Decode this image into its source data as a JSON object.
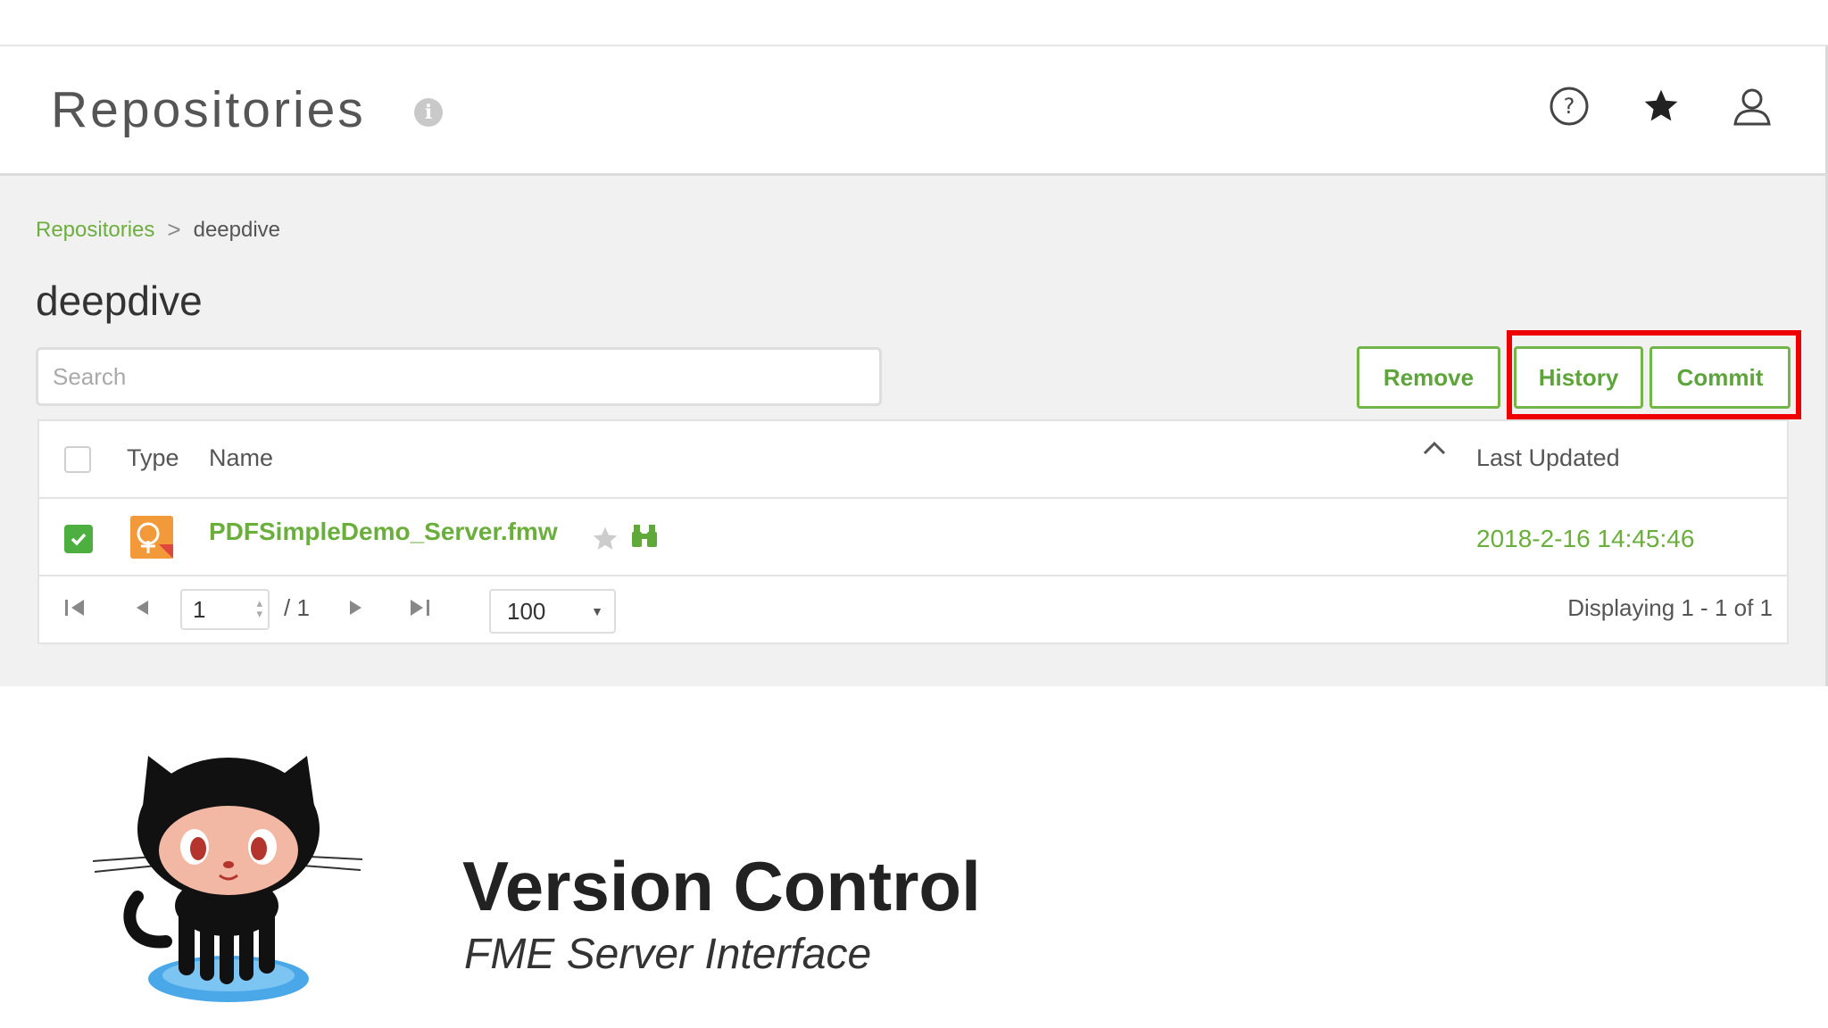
{
  "header": {
    "title": "Repositories",
    "info_icon": "info-icon",
    "help_icon": "help-circle-icon",
    "favorites_icon": "star-icon",
    "user_icon": "user-icon"
  },
  "breadcrumb": {
    "root": "Repositories",
    "separator": ">",
    "current": "deepdive"
  },
  "page": {
    "title": "deepdive"
  },
  "search": {
    "placeholder": "Search",
    "value": ""
  },
  "actions": {
    "remove": "Remove",
    "history": "History",
    "commit": "Commit"
  },
  "table": {
    "columns": {
      "type": "Type",
      "name": "Name",
      "last_updated": "Last Updated"
    },
    "sort": "ascending",
    "rows": [
      {
        "selected": true,
        "type_icon": "fmw-workspace-icon",
        "name": "PDFSimpleDemo_Server.fmw",
        "last_updated": "2018-2-16 14:45:46"
      }
    ]
  },
  "pagination": {
    "page": "1",
    "of": "/ 1",
    "page_size": "100",
    "displaying": "Displaying 1 - 1 of 1"
  },
  "slide": {
    "title": "Version Control",
    "subtitle": "FME Server Interface",
    "logo": "octocat-logo"
  },
  "colors": {
    "accent": "#6aae3c",
    "highlight": "#ee0000",
    "checkbox": "#4caf3f"
  }
}
